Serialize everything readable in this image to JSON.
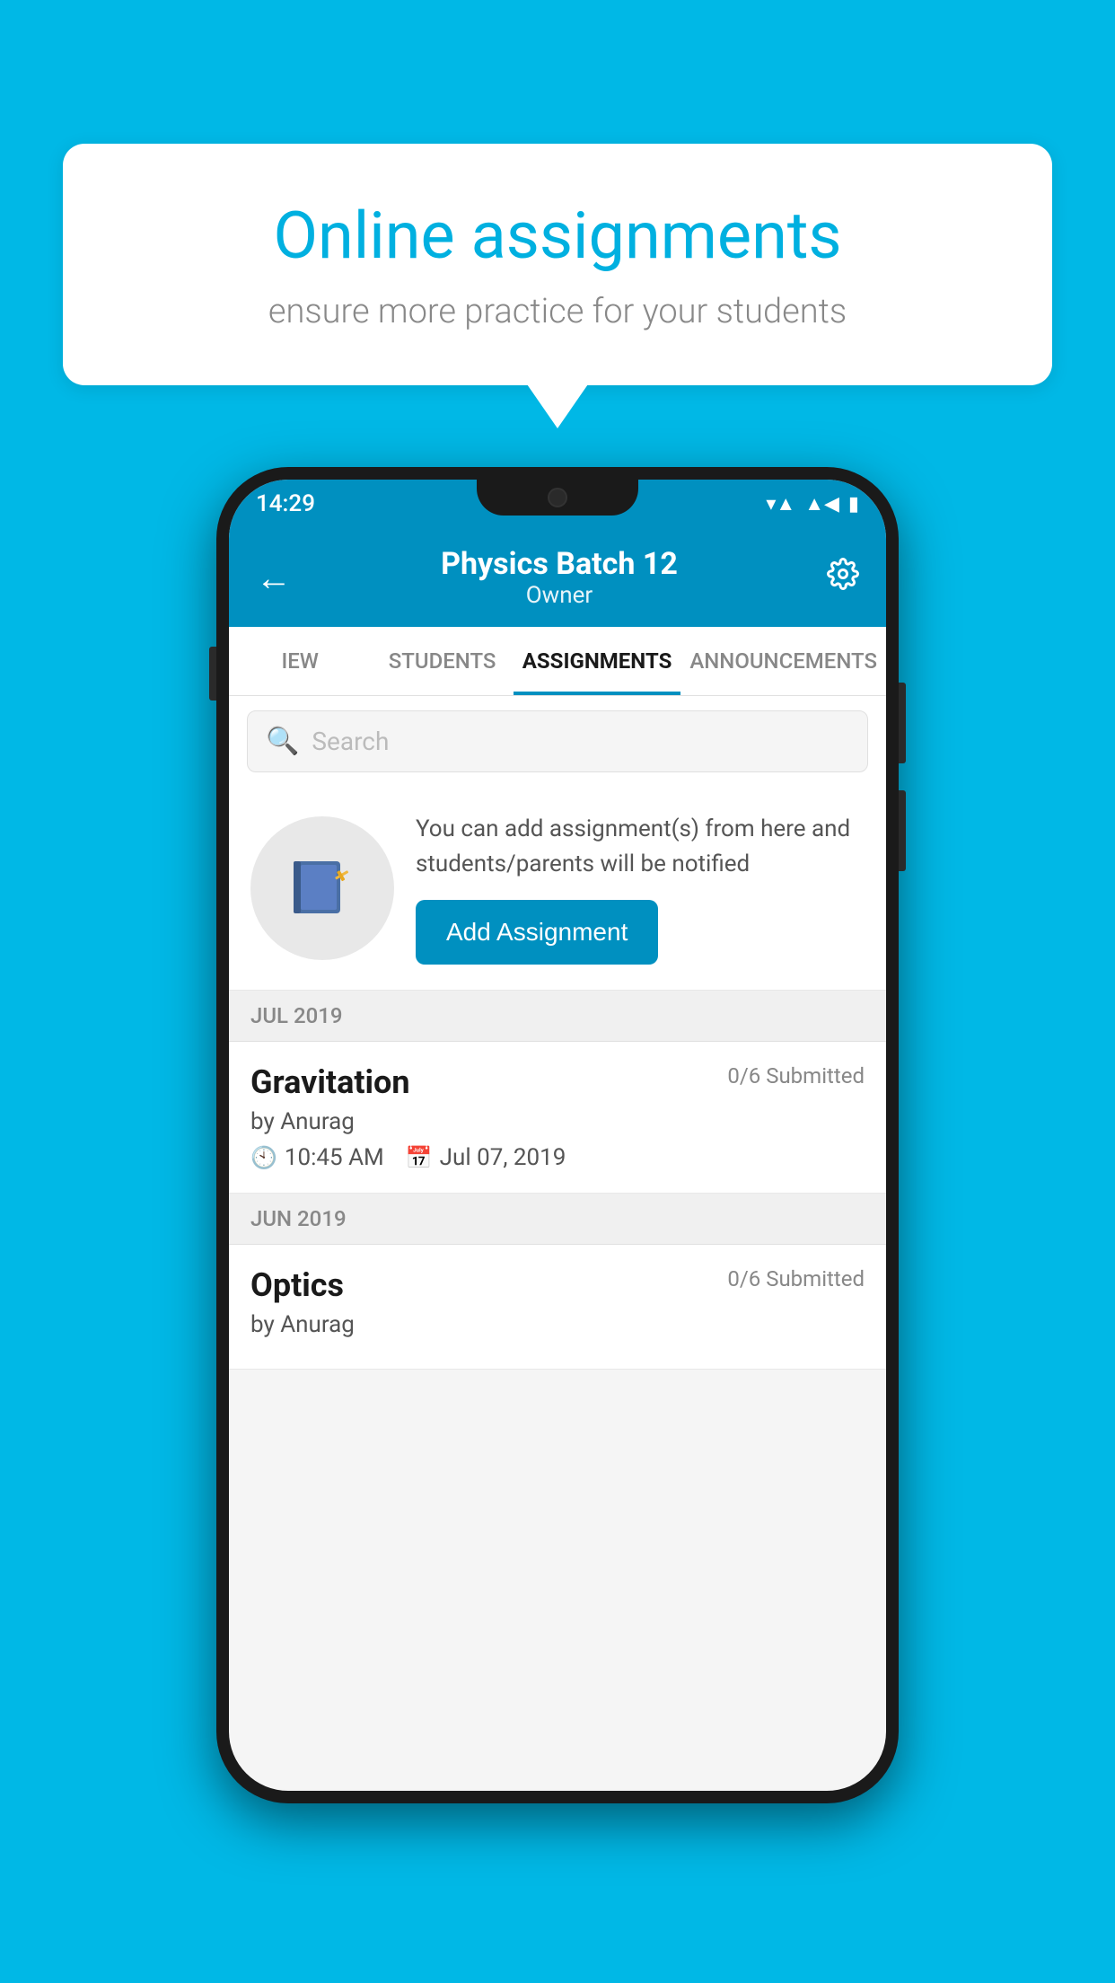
{
  "background": {
    "color": "#00b8e6"
  },
  "speech_bubble": {
    "title": "Online assignments",
    "subtitle": "ensure more practice for your students"
  },
  "phone": {
    "status_bar": {
      "time": "14:29"
    },
    "header": {
      "title": "Physics Batch 12",
      "subtitle": "Owner"
    },
    "tabs": [
      {
        "label": "IEW",
        "active": false
      },
      {
        "label": "STUDENTS",
        "active": false
      },
      {
        "label": "ASSIGNMENTS",
        "active": true
      },
      {
        "label": "ANNOUNCEMENTS",
        "active": false
      }
    ],
    "search": {
      "placeholder": "Search"
    },
    "promo": {
      "text": "You can add assignment(s) from here and students/parents will be notified",
      "button_label": "Add Assignment"
    },
    "sections": [
      {
        "month": "JUL 2019",
        "assignments": [
          {
            "title": "Gravitation",
            "submitted": "0/6 Submitted",
            "author": "by Anurag",
            "time": "10:45 AM",
            "date": "Jul 07, 2019"
          }
        ]
      },
      {
        "month": "JUN 2019",
        "assignments": [
          {
            "title": "Optics",
            "submitted": "0/6 Submitted",
            "author": "by Anurag",
            "time": "",
            "date": ""
          }
        ]
      }
    ]
  }
}
